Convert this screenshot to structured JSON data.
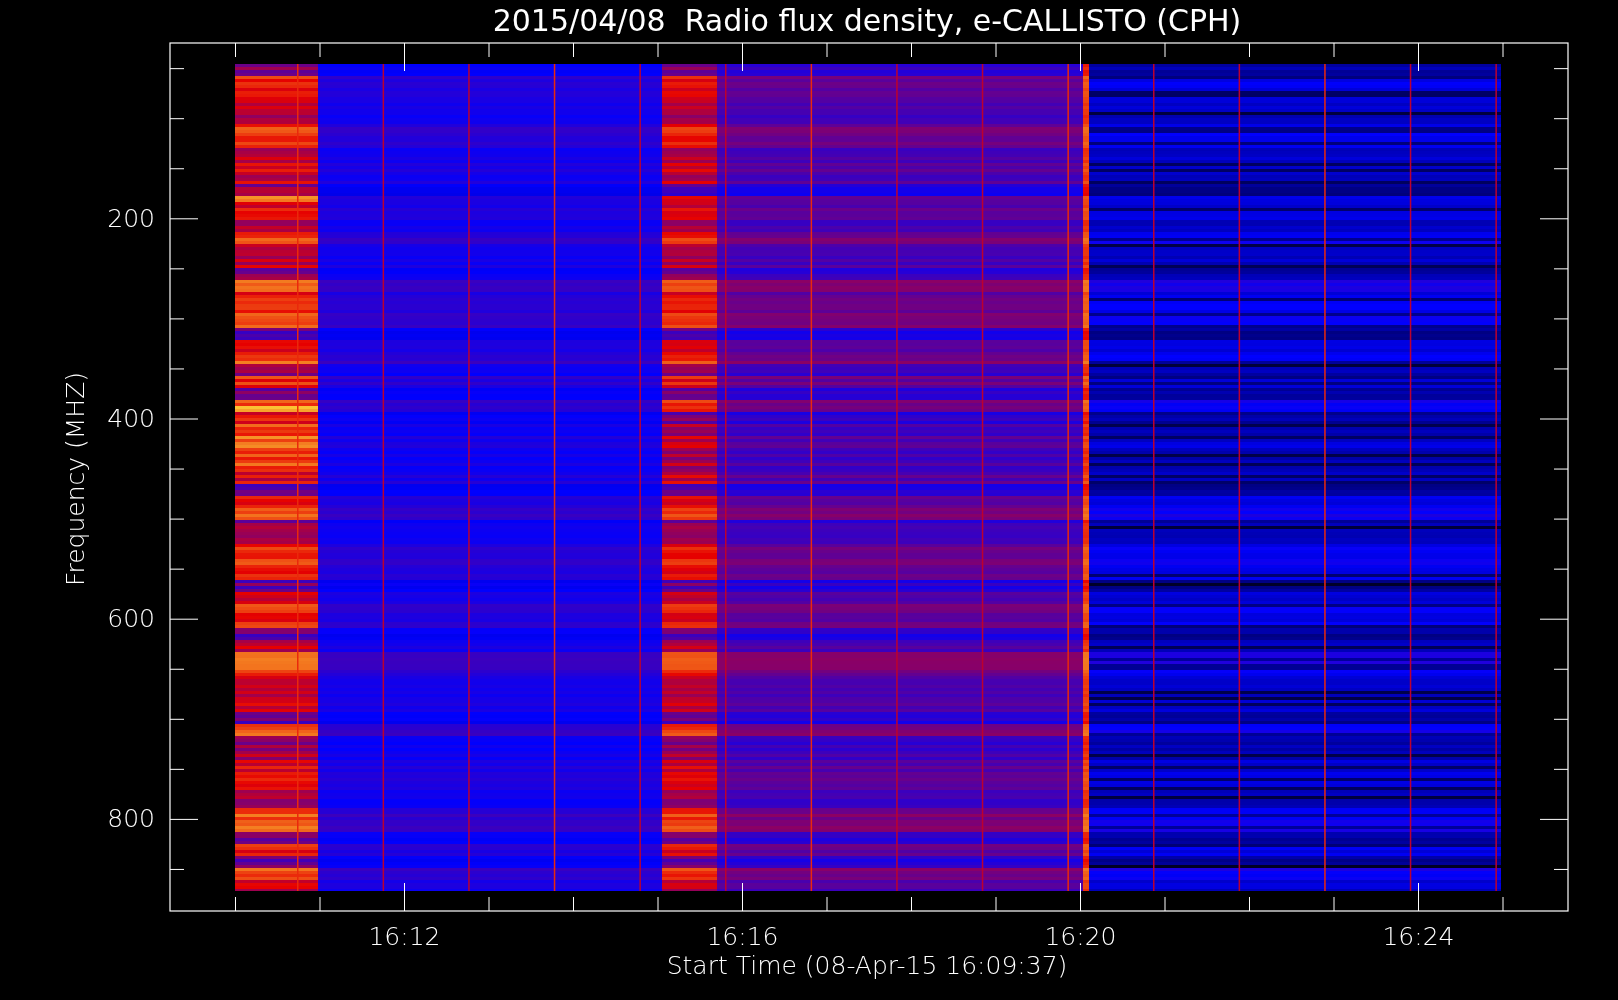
{
  "title": "2015/04/08  Radio flux density, e-CALLISTO (CPH)",
  "y_axis": {
    "label": "Frequency (MHZ)",
    "ticks": [
      "200",
      "400",
      "600",
      "800"
    ]
  },
  "x_axis": {
    "label": "Start Time (08-Apr-15 16:09:37)",
    "ticks": [
      "16:12",
      "16:16",
      "16:20",
      "16:24"
    ]
  }
}
